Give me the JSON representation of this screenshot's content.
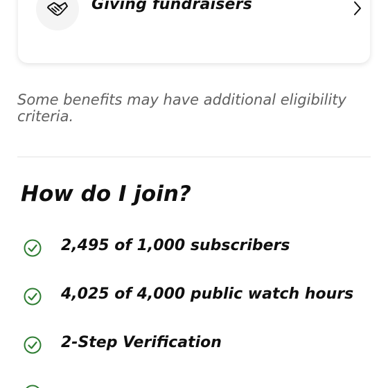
{
  "benefit_card": {
    "label": "Giving fundraisers",
    "icon": "handshake-heart-icon"
  },
  "eligibility_note": "Some benefits may have additional eligibility criteria.",
  "join_section": {
    "heading": "How do I join?",
    "requirements": [
      {
        "text": "2,495 of 1,000 subscribers",
        "status": "met",
        "icon": "check-circle-icon"
      },
      {
        "text": "4,025 of 4,000 public watch hours",
        "status": "met",
        "icon": "check-circle-icon"
      },
      {
        "text": "2-Step Verification",
        "status": "met",
        "icon": "check-circle-icon"
      }
    ]
  },
  "colors": {
    "check": "#2e7d32",
    "muted_text": "#606060",
    "divider": "#e2e2e2"
  }
}
